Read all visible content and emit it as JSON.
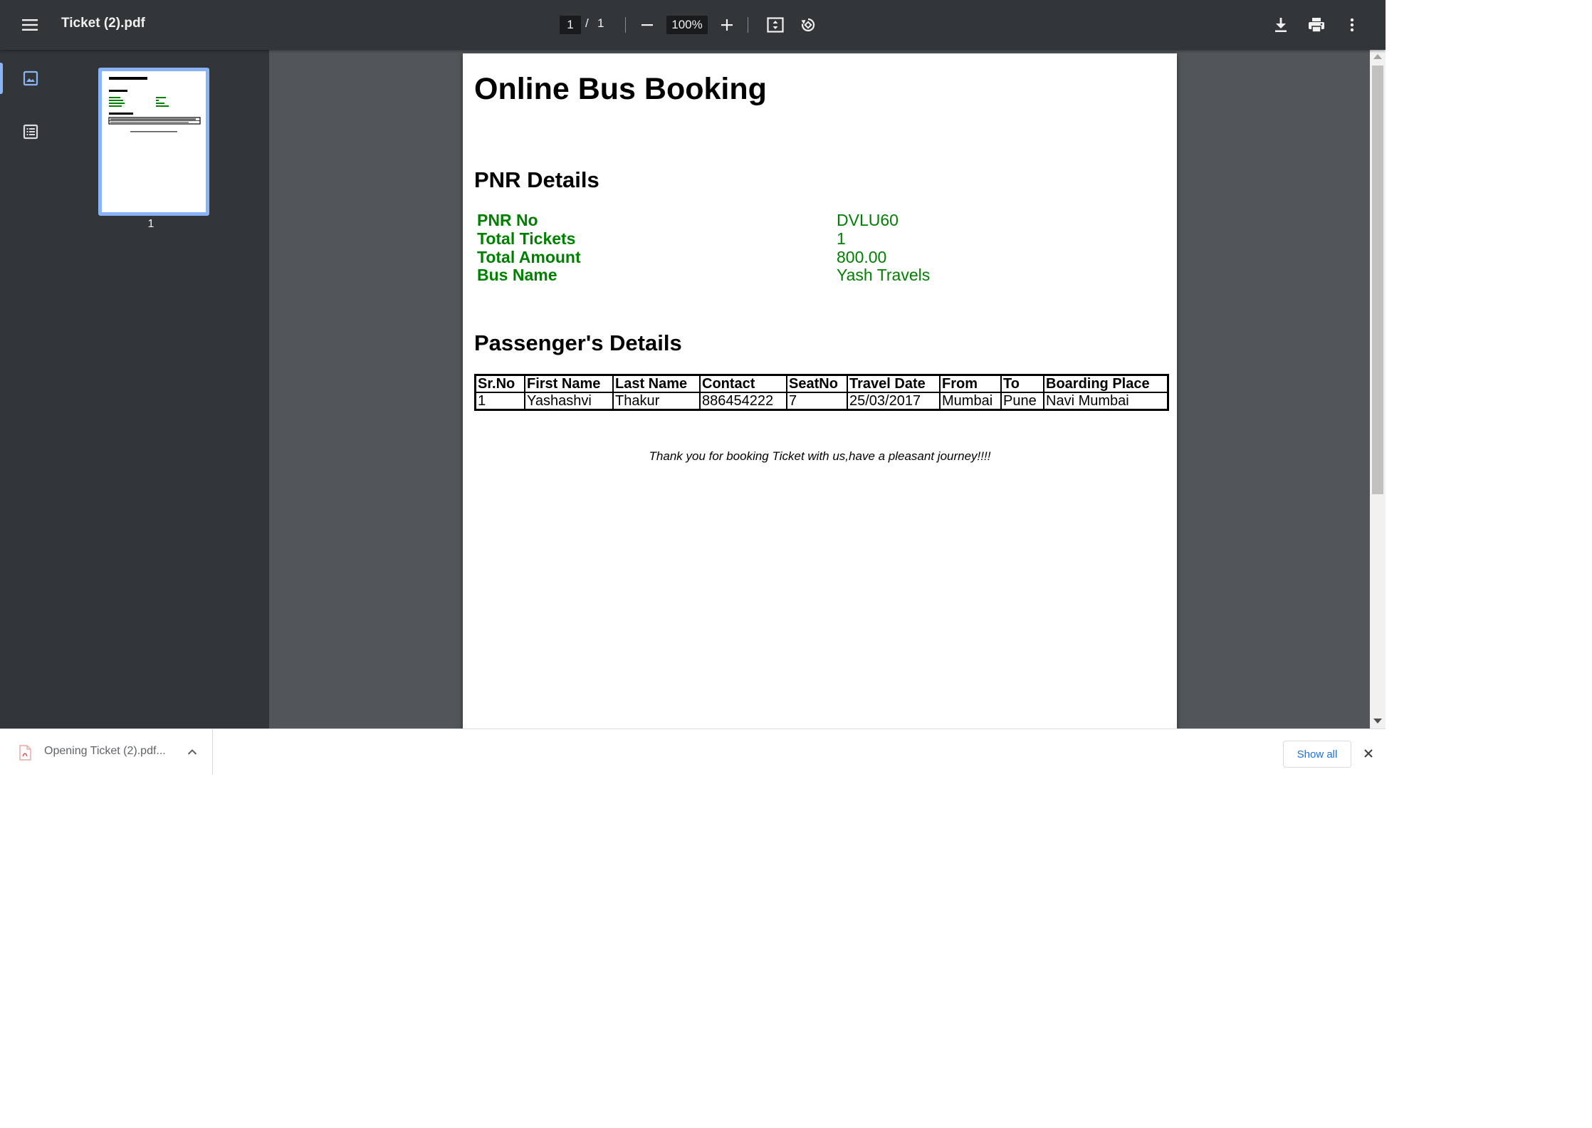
{
  "toolbar": {
    "title": "Ticket (2).pdf",
    "page_current": "1",
    "page_separator": "/",
    "page_total": "1",
    "zoom": "100%",
    "icons": [
      "menu-icon",
      "zoom-out-icon",
      "zoom-in-icon",
      "fit-to-page-icon",
      "rotate-icon",
      "download-icon",
      "print-icon",
      "more-vert-icon"
    ]
  },
  "sidebar": {
    "tabs": [
      "thumbnails-icon",
      "outline-icon"
    ],
    "thumbnail_page_number": "1"
  },
  "document": {
    "title": "Online Bus Booking",
    "pnr_heading": "PNR Details",
    "pnr_details": [
      {
        "label": "PNR No",
        "value": "DVLU60"
      },
      {
        "label": "Total Tickets",
        "value": "1"
      },
      {
        "label": "Total Amount",
        "value": "800.00"
      },
      {
        "label": "Bus Name",
        "value": "Yash Travels"
      }
    ],
    "passenger_heading": "Passenger's Details",
    "passenger_table": {
      "headers": [
        "Sr.No",
        "First Name",
        "Last Name",
        "Contact",
        "SeatNo",
        "Travel Date",
        "From",
        "To",
        "Boarding Place"
      ],
      "rows": [
        [
          "1",
          "Yashashvi",
          "Thakur",
          "886454222",
          "7",
          "25/03/2017",
          "Mumbai",
          "Pune",
          "Navi Mumbai"
        ]
      ]
    },
    "footer_note": "Thank you for booking Ticket with us,have a pleasant journey!!!!"
  },
  "download_bar": {
    "item_label": "Opening Ticket (2).pdf...",
    "show_all_label": "Show all"
  },
  "colors": {
    "toolbar_bg": "#323639",
    "viewer_bg": "#525659",
    "accent": "#8ab4f8",
    "detail_green": "#008000",
    "link_blue": "#1a73e8"
  }
}
